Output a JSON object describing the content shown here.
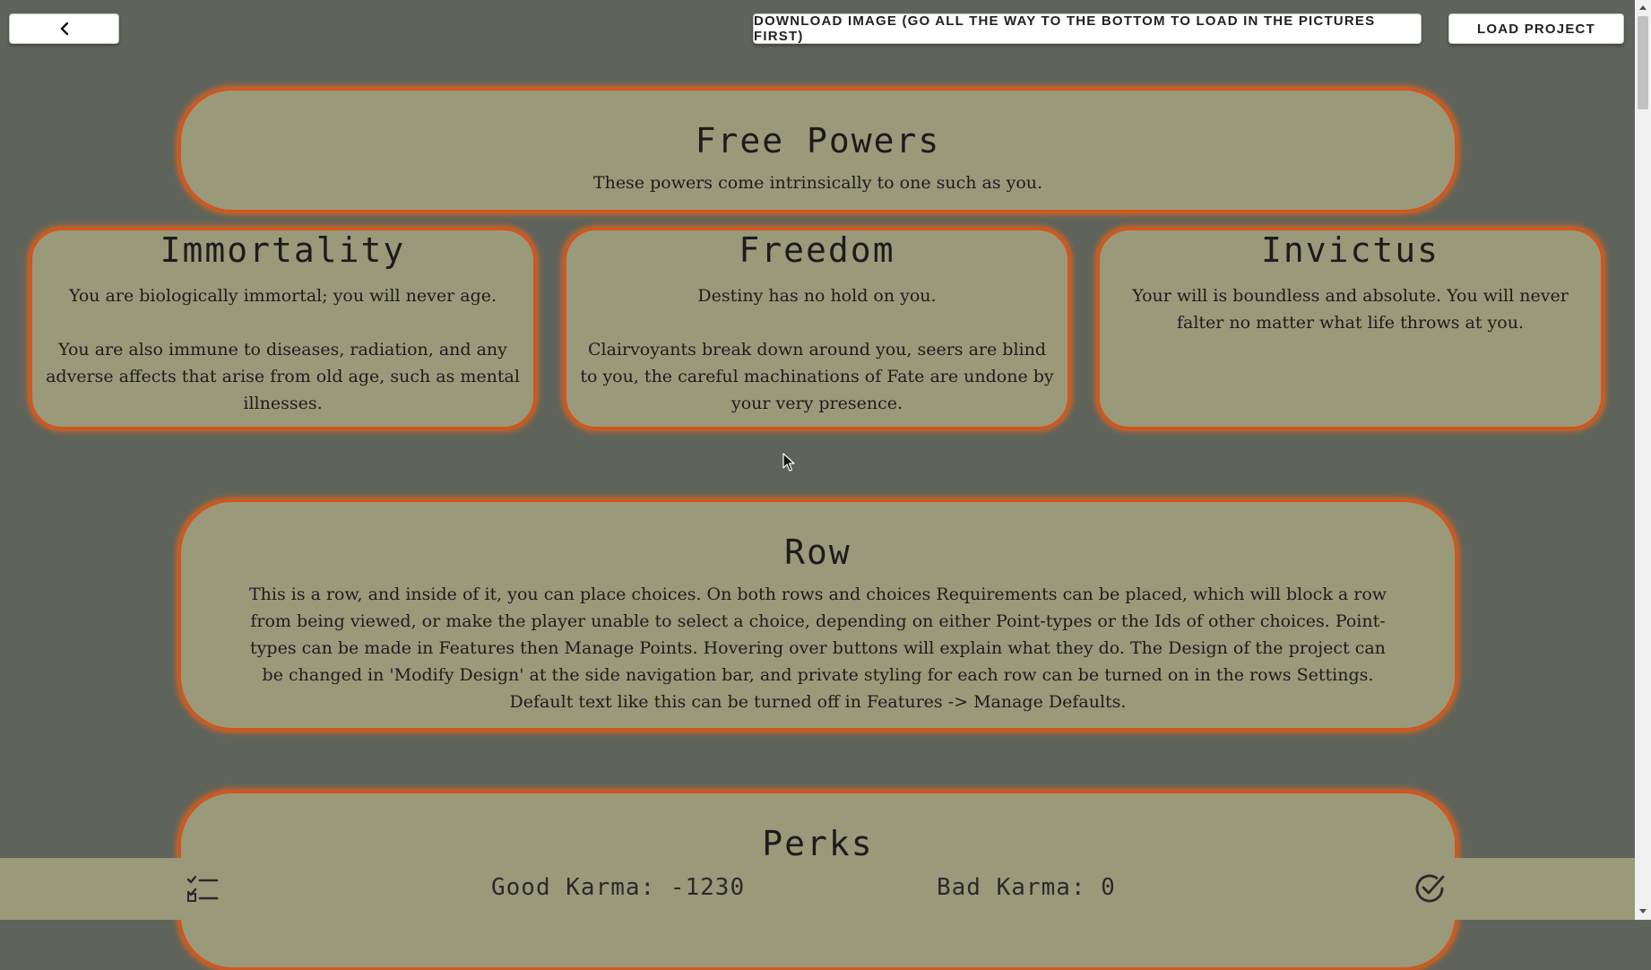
{
  "toolbar": {
    "back_icon": "chevron-left-icon",
    "download_label": "DOWNLOAD IMAGE (GO ALL THE WAY TO THE BOTTOM TO LOAD IN THE PICTURES FIRST)",
    "load_label": "LOAD PROJECT"
  },
  "rows": {
    "free_powers": {
      "title": "Free Powers",
      "text": "These powers come intrinsically to one such as you."
    },
    "row": {
      "title": "Row",
      "text": "This is a row, and inside of it, you can place choices. On both rows and choices Requirements can be placed, which will block a row from being viewed, or make the player unable to select a choice, depending on either Point-types or the Ids of other choices. Point-types can be made in Features then Manage Points. Hovering over buttons will explain what they do. The Design of the project can be changed in 'Modify Design' at the side navigation bar, and private styling for each row can be turned on in the rows Settings. Default text like this can be turned off in Features -> Manage Defaults."
    },
    "perks": {
      "title": "Perks"
    }
  },
  "cards": [
    {
      "title": "Immortality",
      "text": "You are biologically immortal; you will never age.\n\nYou are also immune to diseases, radiation, and any adverse affects that arise from old age, such as mental illnesses."
    },
    {
      "title": "Freedom",
      "text": "Destiny has no hold on you.\n\nClairvoyants break down around you, seers are blind to you, the careful machinations of Fate are undone by your very presence."
    },
    {
      "title": "Invictus",
      "text": "Your will is boundless and absolute. You will never falter no matter what life throws at you."
    }
  ],
  "bottom_bar": {
    "good_karma": "Good Karma: -1230",
    "bad_karma": "Bad Karma: 0",
    "left_icon": "checklist-icon",
    "right_icon": "check-circle-icon"
  },
  "colors": {
    "background": "#5e645b",
    "panel": "#9a9a7b",
    "accent_border": "#d2561c"
  }
}
